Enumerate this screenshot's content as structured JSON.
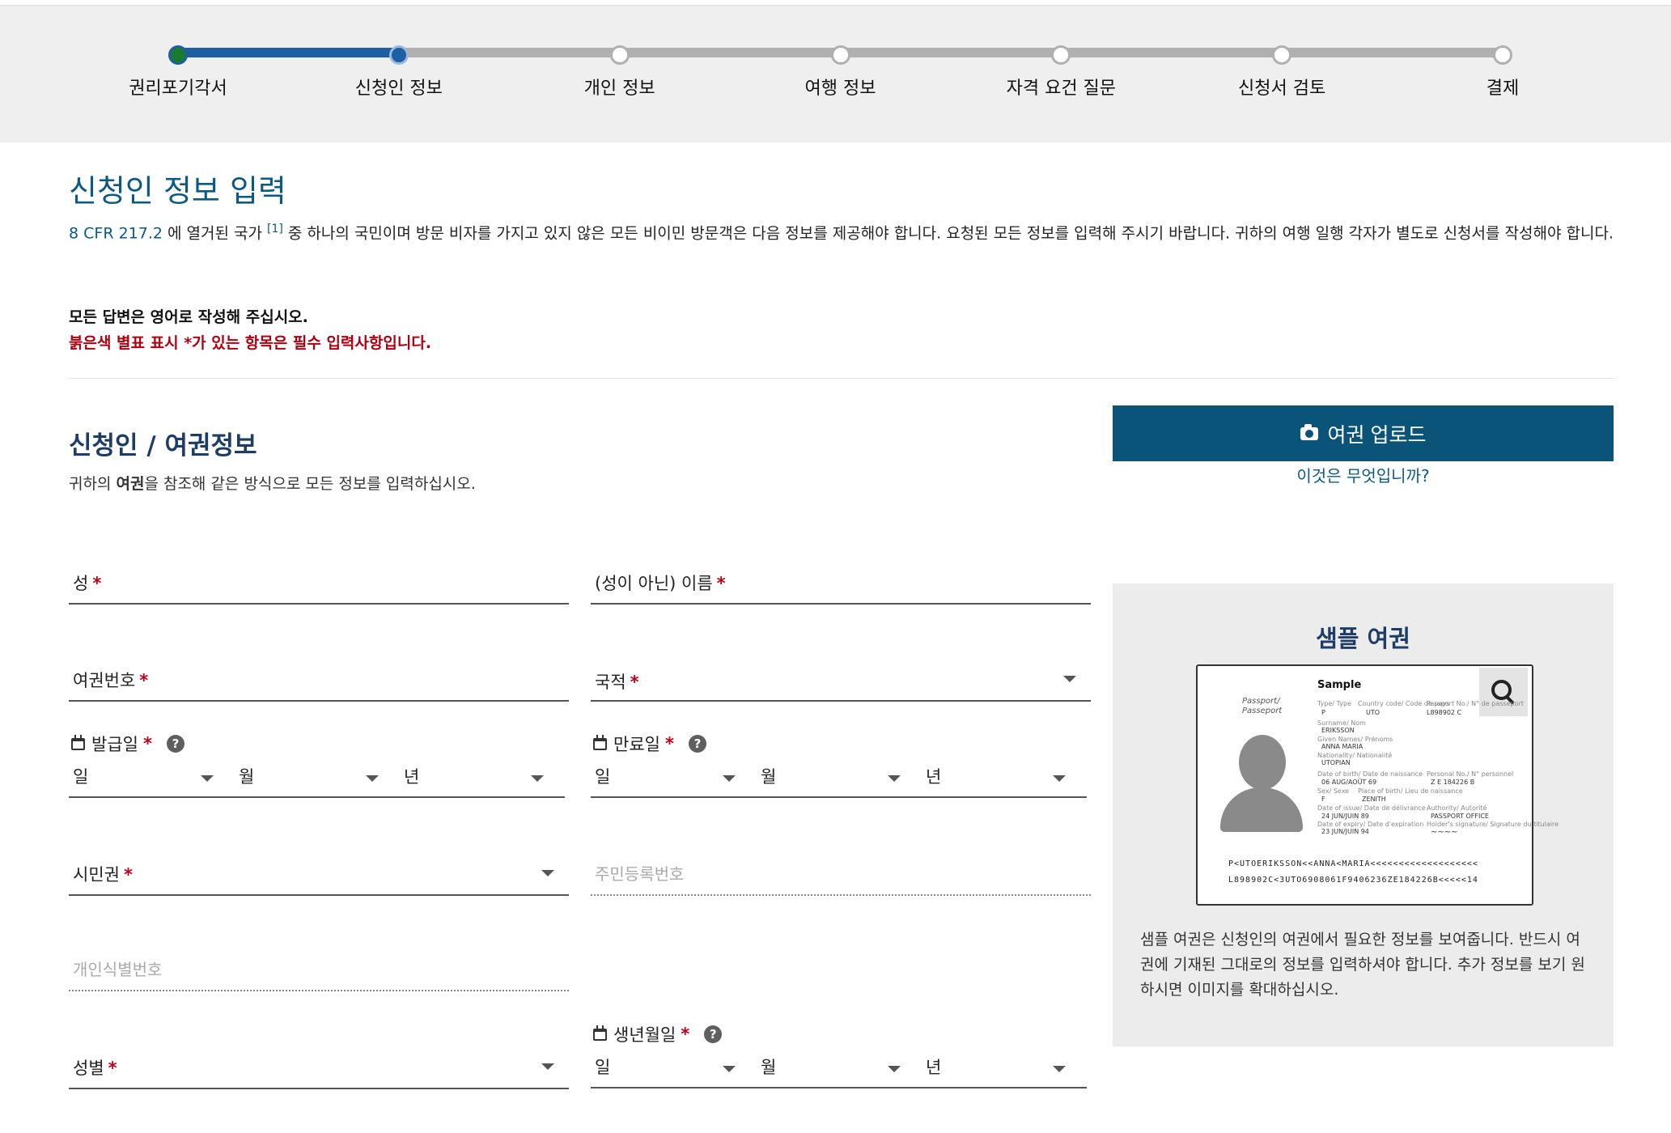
{
  "progress": {
    "steps": [
      {
        "label": "권리포기각서",
        "state": "done"
      },
      {
        "label": "신청인 정보",
        "state": "current"
      },
      {
        "label": "개인 정보",
        "state": "todo"
      },
      {
        "label": "여행 정보",
        "state": "todo"
      },
      {
        "label": "자격 요건 질문",
        "state": "todo"
      },
      {
        "label": "신청서 검토",
        "state": "todo"
      },
      {
        "label": "결제",
        "state": "todo"
      }
    ]
  },
  "page": {
    "title": "신청인 정보 입력",
    "intro_ref": "8 CFR 217.2",
    "intro_a": " 에 열거된 국가 ",
    "intro_sup": "[1]",
    "intro_b": " 중 하나의 국민이며 방문 비자를 가지고 있지 않은 모든 비이민 방문객은 다음 정보를 제공해야 합니다. 요청된 모든 정보를 입력해 주시기 바랍니다. 귀하의 여행 일행 각자가 별도로 신청서를 작성해야 합니다.",
    "note_english": "모든 답변은 영어로 작성해 주십시오.",
    "note_required": "붉은색 별표 표시 *가 있는 항목은 필수 입력사항입니다."
  },
  "section": {
    "title": "신청인 / 여권정보",
    "subtitle_a": "귀하의 ",
    "subtitle_bold": "여권",
    "subtitle_b": "을 참조해 같은 방식으로 모든 정보를 입력하십시오."
  },
  "upload": {
    "button": "여권 업로드",
    "icon": "camera-icon",
    "help_link": "이것은 무엇입니까?"
  },
  "form": {
    "surname": "성",
    "given_name": "(성이 아닌) 이름",
    "passport_no": "여권번호",
    "nationality": "국적",
    "issue_date": "발급일",
    "expiry_date": "만료일",
    "citizenship": "시민권",
    "national_id": "주민등록번호",
    "personal_id": "개인식별번호",
    "sex": "성별",
    "birth_date": "생년월일",
    "day": "일",
    "month": "월",
    "year": "년",
    "required_mark": "*",
    "help_mark": "?"
  },
  "sample": {
    "title": "샘플 여권",
    "passport_word": "Passport/\nPasseport",
    "sample_label": "Sample",
    "fields": {
      "type_lbl": "Type/ Type",
      "type_val": "P",
      "country_lbl": "Country code/ Code de pays",
      "country_val": "UTO",
      "passno_lbl": "Passport No./ N° de passeport",
      "passno_val": "L898902 C",
      "surname_lbl": "Surname/ Nom",
      "surname_val": "ERIKSSON",
      "given_lbl": "Given Names/ Prénoms",
      "given_val": "ANNA MARIA",
      "nat_lbl": "Nationality/ Nationalité",
      "nat_val": "UTOPIAN",
      "dob_lbl": "Date of birth/ Date de naissance",
      "dob_val": "06 AUG/AOÛT 69",
      "pid_lbl": "Personal No./ N° personnel",
      "pid_val": "Z E 184226 B",
      "sex_lbl": "Sex/ Sexe",
      "sex_val": "F",
      "pob_lbl": "Place of birth/ Lieu de naissance",
      "pob_val": "ZENITH",
      "doi_lbl": "Date of issue/ Date de délivrance",
      "doi_val": "24 JUN/JUIN 89",
      "auth_lbl": "Authority/ Autorité",
      "auth_val": "PASSPORT OFFICE",
      "doe_lbl": "Date of expiry/ Date d'expiration",
      "doe_val": "23 JUN/JUIN 94",
      "sig_lbl": "Holder's signature/ Signature du titulaire"
    },
    "mrz_line1": "P<UTOERIKSSON<<ANNA<MARIA<<<<<<<<<<<<<<<<<<<",
    "mrz_line2": "L898902C<3UTO6908061F9406236ZE184226B<<<<<14",
    "description": "샘플 여권은 신청인의 여권에서 필요한 정보를 보여줍니다. 반드시 여권에 기재된 그대로의 정보를 입력하셔야 합니다. 추가 정보를 보기 원하시면 이미지를 확대하십시오."
  },
  "colors": {
    "accent": "#0b5479",
    "progress_fill": "#1d5fa0",
    "required": "#c00018",
    "done_dot": "#1a7a2e"
  }
}
